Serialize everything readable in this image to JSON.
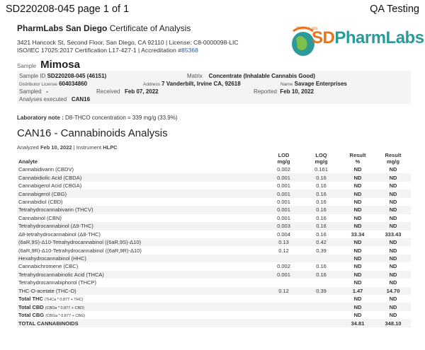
{
  "header": {
    "doc_id": "SD220208-045 page 1 of 1",
    "qa": "QA Testing"
  },
  "lab": {
    "name_bold": "PharmLabs San Diego",
    "name_rest": " Certificate of Analysis",
    "address": "3421 Hancock St, Second Floor, San Diego, CA 92110 | License: C8-0000098-LIC",
    "cert": "ISO/IEC 17025:2017 Certification L17-427-1 | Accreditation #",
    "accreditation": "85368",
    "logo_sd": "SD",
    "logo_pharmlabs": "PharmLabs",
    "logo_badge": "PharmLabs",
    "colors": {
      "orange": "#e8731c",
      "teal": "#2d9a9a",
      "green": "#2ea043",
      "blue": "#2a4ba8"
    }
  },
  "sample": {
    "label": "Sample",
    "name": "Mimosa",
    "id_label": "Sample ID",
    "id": "SD220208-045 (46151)",
    "matrix_label": "Matrix",
    "matrix": "Concentrate (Inhalable Cannabis Good)",
    "distributor_label": "Distributor License",
    "distributor": "604034860",
    "address_label": "Address",
    "address": "7 Vanderbilt, Irvine CA, 92618",
    "name_label": "Name",
    "client_name": "Savage Enterprises",
    "sampled_label": "Sampled",
    "sampled": "-",
    "received_label": "Received",
    "received": "Feb 07, 2022",
    "reported_label": "Reported",
    "reported": "Feb 10, 2022",
    "analyses_label": "Analyses executed",
    "analyses": "CAN16"
  },
  "lab_note": {
    "label": "Laboratory note :",
    "text": " D8-THCO concentration = 339 mg/g (33.9%)"
  },
  "section": {
    "title": "CAN16 - Cannabinoids Analysis",
    "analyzed_label": "Analyzed",
    "analyzed_date": "Feb 10, 2022",
    "instrument_label": "Instrument",
    "instrument": "HLPC"
  },
  "table": {
    "headers": {
      "analyte": "Analyte",
      "lod": "LOD",
      "lod_unit": "mg/g",
      "loq": "LOQ",
      "loq_unit": "mg/g",
      "res_pct": "Result",
      "res_pct_unit": "%",
      "res_mg": "Result",
      "res_mg_unit": "mg/g"
    },
    "rows": [
      {
        "analyte": "Cannabidivarin (CBDV)",
        "lod": "0.002",
        "loq": "0.161",
        "pct": "ND",
        "mg": "ND"
      },
      {
        "analyte": "Cannabidiolic Acid (CBDA)",
        "lod": "0.001",
        "loq": "0.16",
        "pct": "ND",
        "mg": "ND"
      },
      {
        "analyte": "Cannabigerol Acid (CBGA)",
        "lod": "0.001",
        "loq": "0.16",
        "pct": "ND",
        "mg": "ND"
      },
      {
        "analyte": "Cannabigerol (CBG)",
        "lod": "0.001",
        "loq": "0.16",
        "pct": "ND",
        "mg": "ND"
      },
      {
        "analyte": "Cannabidiol (CBD)",
        "lod": "0.001",
        "loq": "0.16",
        "pct": "ND",
        "mg": "ND"
      },
      {
        "analyte": "Tetrahydrocannabivarin (THCV)",
        "lod": "0.001",
        "loq": "0.16",
        "pct": "ND",
        "mg": "ND"
      },
      {
        "analyte": "Cannabinol (CBN)",
        "lod": "0.001",
        "loq": "0.16",
        "pct": "ND",
        "mg": "ND"
      },
      {
        "analyte": "Tetrahydrocannabinol (Δ9-THC)",
        "lod": "0.003",
        "loq": "0.16",
        "pct": "ND",
        "mg": "ND"
      },
      {
        "analyte": "Δ8-tetrahydrocannabinol (Δ8-THC)",
        "lod": "0.004",
        "loq": "0.16",
        "pct": "33.34",
        "mg": "333.43"
      },
      {
        "analyte": "(6aR,9S)-Δ10-Tetrahydrocannabinol ((6aR,9S)-Δ10)",
        "lod": "0.13",
        "loq": "0.42",
        "pct": "ND",
        "mg": "ND"
      },
      {
        "analyte": "(6aR,9R)-Δ10-Tetrahydrocannabinol ((6aR,9R)-Δ10)",
        "lod": "0.12",
        "loq": "0.39",
        "pct": "ND",
        "mg": "ND"
      },
      {
        "analyte": "Hexahydrocannabinol (HHC)",
        "lod": "",
        "loq": "",
        "pct": "ND",
        "mg": "ND"
      },
      {
        "analyte": "Cannabichromene (CBC)",
        "lod": "0.002",
        "loq": "0.16",
        "pct": "ND",
        "mg": "ND"
      },
      {
        "analyte": "Tetrahydrocannabinolic Acid (THCA)",
        "lod": "0.001",
        "loq": "0.16",
        "pct": "ND",
        "mg": "ND"
      },
      {
        "analyte": "Tetrahydrocannabiphorol (THCP)",
        "lod": "",
        "loq": "",
        "pct": "ND",
        "mg": "ND"
      },
      {
        "analyte": "THC-O-acetate (THC-O)",
        "lod": "0.12",
        "loq": "0.39",
        "pct": "1.47",
        "mg": "14.70"
      }
    ],
    "totals": [
      {
        "label": "Total THC",
        "sub": "(THCa * 0.877 + THC)",
        "pct": "ND",
        "mg": "ND"
      },
      {
        "label": "Total CBD",
        "sub": "(CBDa * 0.877 + CBD)",
        "pct": "ND",
        "mg": "ND"
      },
      {
        "label": "Total CBG",
        "sub": "(CBGa * 0.877 + CBG)",
        "pct": "ND",
        "mg": "ND"
      }
    ],
    "grand_total": {
      "label": "TOTAL CANNABINOIDS",
      "pct": "34.81",
      "mg": "348.10"
    }
  }
}
